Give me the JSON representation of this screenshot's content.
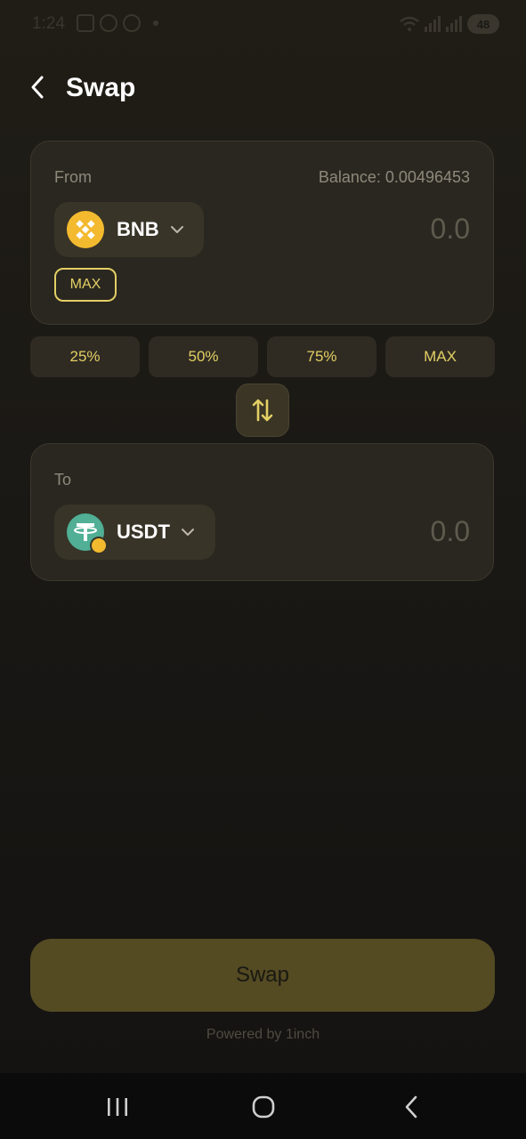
{
  "status_bar": {
    "time": "1:24",
    "battery": "48"
  },
  "header": {
    "title": "Swap",
    "back_icon": "chevron-left-icon"
  },
  "from_card": {
    "label": "From",
    "balance": "Balance: 0.00496453",
    "token": {
      "symbol": "BNB",
      "icon": "bnb-token-icon",
      "color": "#f3ba2f"
    },
    "amount_placeholder": "0.0",
    "max_label": "MAX"
  },
  "percent_buttons": [
    "25%",
    "50%",
    "75%",
    "MAX"
  ],
  "switch_icon": "swap-vertical-icon",
  "to_card": {
    "label": "To",
    "token": {
      "symbol": "USDT",
      "icon": "usdt-token-icon",
      "color": "#50af95"
    },
    "amount_placeholder": "0.0"
  },
  "swap_button": {
    "label": "Swap"
  },
  "footer": {
    "powered_by": "Powered by 1inch"
  },
  "colors": {
    "accent": "#e3cf64",
    "card_bg": "#2a2720",
    "swap_button_bg": "#544b23"
  }
}
